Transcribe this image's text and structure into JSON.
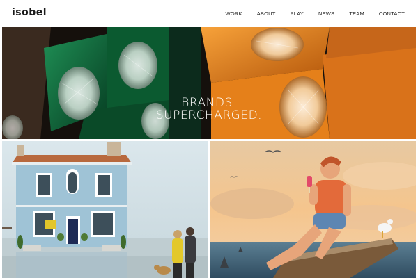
{
  "header": {
    "logo": "isobel",
    "nav": [
      {
        "label": "WORK"
      },
      {
        "label": "ABOUT"
      },
      {
        "label": "PLAY"
      },
      {
        "label": "NEWS"
      },
      {
        "label": "TEAM"
      },
      {
        "label": "CONTACT"
      }
    ]
  },
  "hero": {
    "line1": "BRANDS.",
    "line2": "SUPERCHARGED."
  },
  "colors": {
    "accent_green": "#0f6b3c",
    "accent_orange": "#f08a1e",
    "text_dark": "#222222"
  }
}
